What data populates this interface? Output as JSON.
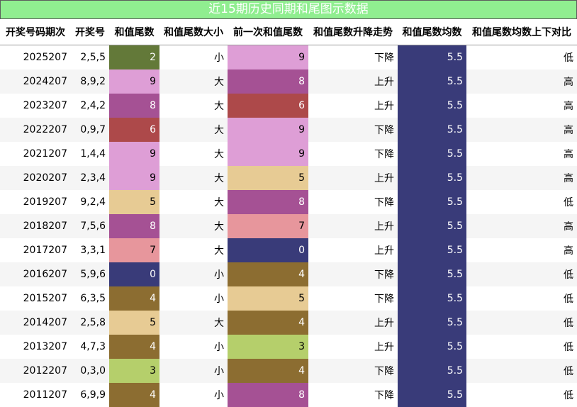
{
  "title": "近15期历史同期和尾图示数据",
  "colors": {
    "0": "#393b79",
    "2": "#637939",
    "3": "#b5cf6b",
    "4": "#8c6d31",
    "5": "#e7cb94",
    "6": "#ad494a",
    "7": "#e7969c",
    "8": "#a55194",
    "9": "#de9ed6",
    "avg": "#393b79"
  },
  "chart_data": {
    "type": "table",
    "columns": [
      "开奖号码期次",
      "开奖号",
      "和值尾数",
      "和值尾数大小",
      "前一次和值尾数",
      "和值尾数升降走势",
      "和值尾数均数",
      "和值尾数均数上下对比"
    ],
    "rows": [
      [
        "2025207",
        "2,5,5",
        2,
        "小",
        9,
        "下降",
        5.5,
        "低"
      ],
      [
        "2024207",
        "8,9,2",
        9,
        "大",
        8,
        "上升",
        5.5,
        "高"
      ],
      [
        "2023207",
        "2,4,2",
        8,
        "大",
        6,
        "上升",
        5.5,
        "高"
      ],
      [
        "2022207",
        "0,9,7",
        6,
        "大",
        9,
        "下降",
        5.5,
        "高"
      ],
      [
        "2021207",
        "1,4,4",
        9,
        "大",
        9,
        "下降",
        5.5,
        "高"
      ],
      [
        "2020207",
        "2,3,4",
        9,
        "大",
        5,
        "上升",
        5.5,
        "高"
      ],
      [
        "2019207",
        "9,2,4",
        5,
        "大",
        8,
        "下降",
        5.5,
        "低"
      ],
      [
        "2018207",
        "7,5,6",
        8,
        "大",
        7,
        "上升",
        5.5,
        "高"
      ],
      [
        "2017207",
        "3,3,1",
        7,
        "大",
        0,
        "上升",
        5.5,
        "高"
      ],
      [
        "2016207",
        "5,9,6",
        0,
        "小",
        4,
        "下降",
        5.5,
        "低"
      ],
      [
        "2015207",
        "6,3,5",
        4,
        "小",
        5,
        "下降",
        5.5,
        "低"
      ],
      [
        "2014207",
        "2,5,8",
        5,
        "大",
        4,
        "上升",
        5.5,
        "低"
      ],
      [
        "2013207",
        "4,7,3",
        4,
        "小",
        3,
        "上升",
        5.5,
        "低"
      ],
      [
        "2012207",
        "0,3,0",
        3,
        "小",
        4,
        "下降",
        5.5,
        "低"
      ],
      [
        "2011207",
        "6,9,9",
        4,
        "小",
        8,
        "下降",
        5.5,
        "低"
      ]
    ]
  }
}
